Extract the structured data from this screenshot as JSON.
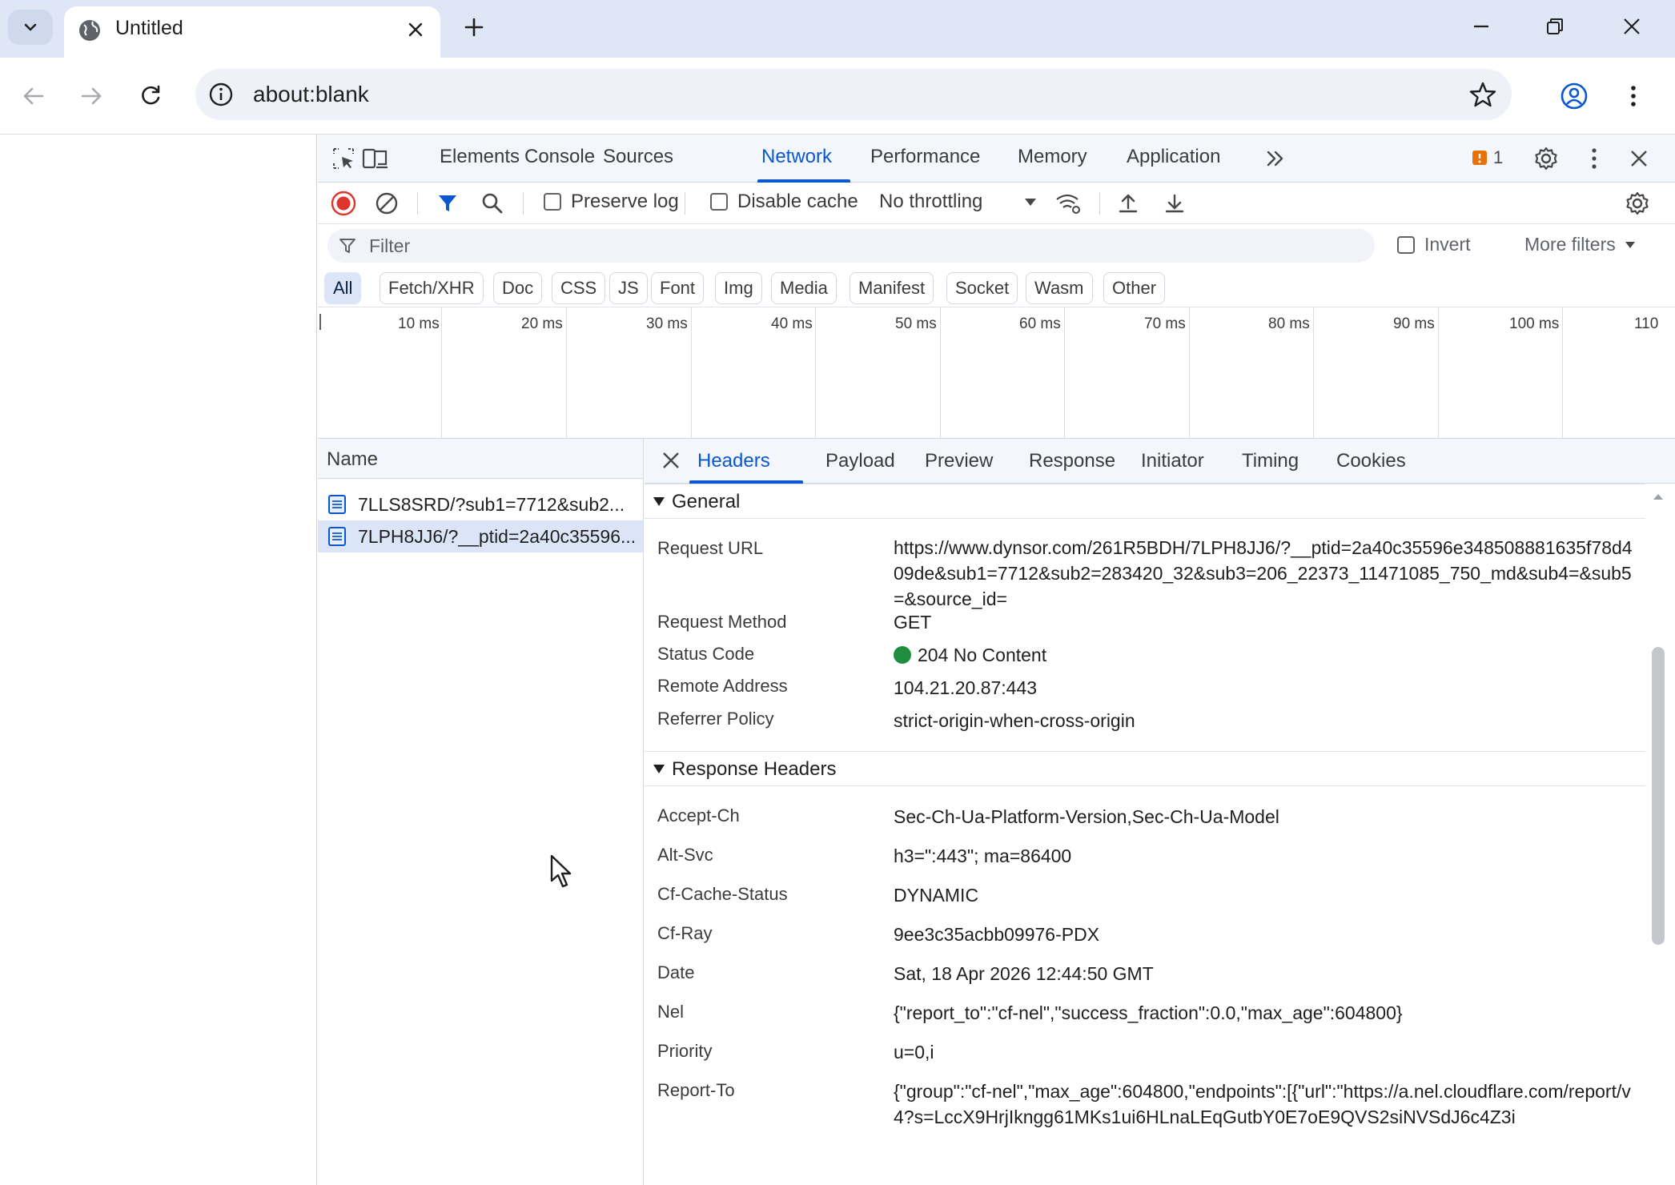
{
  "browser": {
    "tab_title": "Untitled",
    "url": "about:blank"
  },
  "devtools": {
    "tabs": [
      "Elements",
      "Console",
      "Sources",
      "Network",
      "Performance",
      "Memory",
      "Application"
    ],
    "active_tab": "Network",
    "issues_count": "1",
    "toolbar": {
      "preserve_log": "Preserve log",
      "disable_cache": "Disable cache",
      "throttling": "No throttling"
    },
    "filter": {
      "placeholder": "Filter",
      "invert": "Invert",
      "more_filters": "More filters"
    },
    "type_filters": [
      "All",
      "Fetch/XHR",
      "Doc",
      "CSS",
      "JS",
      "Font",
      "Img",
      "Media",
      "Manifest",
      "Socket",
      "Wasm",
      "Other"
    ],
    "active_type_filter": "All",
    "timeline_labels": [
      "10 ms",
      "20 ms",
      "30 ms",
      "40 ms",
      "50 ms",
      "60 ms",
      "70 ms",
      "80 ms",
      "90 ms",
      "100 ms",
      "110"
    ],
    "request_list": {
      "header": "Name",
      "rows": [
        {
          "name": "7LLS8SRD/?sub1=7712&sub2..."
        },
        {
          "name": "7LPH8JJ6/?__ptid=2a40c35596..."
        }
      ],
      "selected_index": 1
    },
    "details": {
      "tabs": [
        "Headers",
        "Payload",
        "Preview",
        "Response",
        "Initiator",
        "Timing",
        "Cookies"
      ],
      "active_tab": "Headers",
      "general": {
        "title": "General",
        "request_url_label": "Request URL",
        "request_url": "https://www.dynsor.com/261R5BDH/7LPH8JJ6/?__ptid=2a40c35596e348508881635f78d409de&sub1=7712&sub2=283420_32&sub3=206_22373_11471085_750_md&sub4=&sub5=&source_id=",
        "request_method_label": "Request Method",
        "request_method": "GET",
        "status_code_label": "Status Code",
        "status_code": "204 No Content",
        "status_color": "#1e8e3e",
        "remote_address_label": "Remote Address",
        "remote_address": "104.21.20.87:443",
        "referrer_policy_label": "Referrer Policy",
        "referrer_policy": "strict-origin-when-cross-origin"
      },
      "response_headers": {
        "title": "Response Headers",
        "items": [
          {
            "key": "Accept-Ch",
            "value": "Sec-Ch-Ua-Platform-Version,Sec-Ch-Ua-Model"
          },
          {
            "key": "Alt-Svc",
            "value": "h3=\":443\"; ma=86400"
          },
          {
            "key": "Cf-Cache-Status",
            "value": "DYNAMIC"
          },
          {
            "key": "Cf-Ray",
            "value": "9ee3c35acbb09976-PDX"
          },
          {
            "key": "Date",
            "value": "Sat, 18 Apr 2026 12:44:50 GMT"
          },
          {
            "key": "Nel",
            "value": "{\"report_to\":\"cf-nel\",\"success_fraction\":0.0,\"max_age\":604800}"
          },
          {
            "key": "Priority",
            "value": "u=0,i"
          },
          {
            "key": "Report-To",
            "value": "{\"group\":\"cf-nel\",\"max_age\":604800,\"endpoints\":[{\"url\":\"https://a.nel.cloudflare.com/report/v4?s=LccX9HrjIkngg61MKs1ui6HLnaLEqGutbY0E7oE9QVS2siNVSdJ6c4Z3i"
          }
        ]
      }
    }
  },
  "colors": {
    "accent": "#0b57d0",
    "tabstrip": "#dfe7f7",
    "selected_row": "#dce5f8"
  }
}
